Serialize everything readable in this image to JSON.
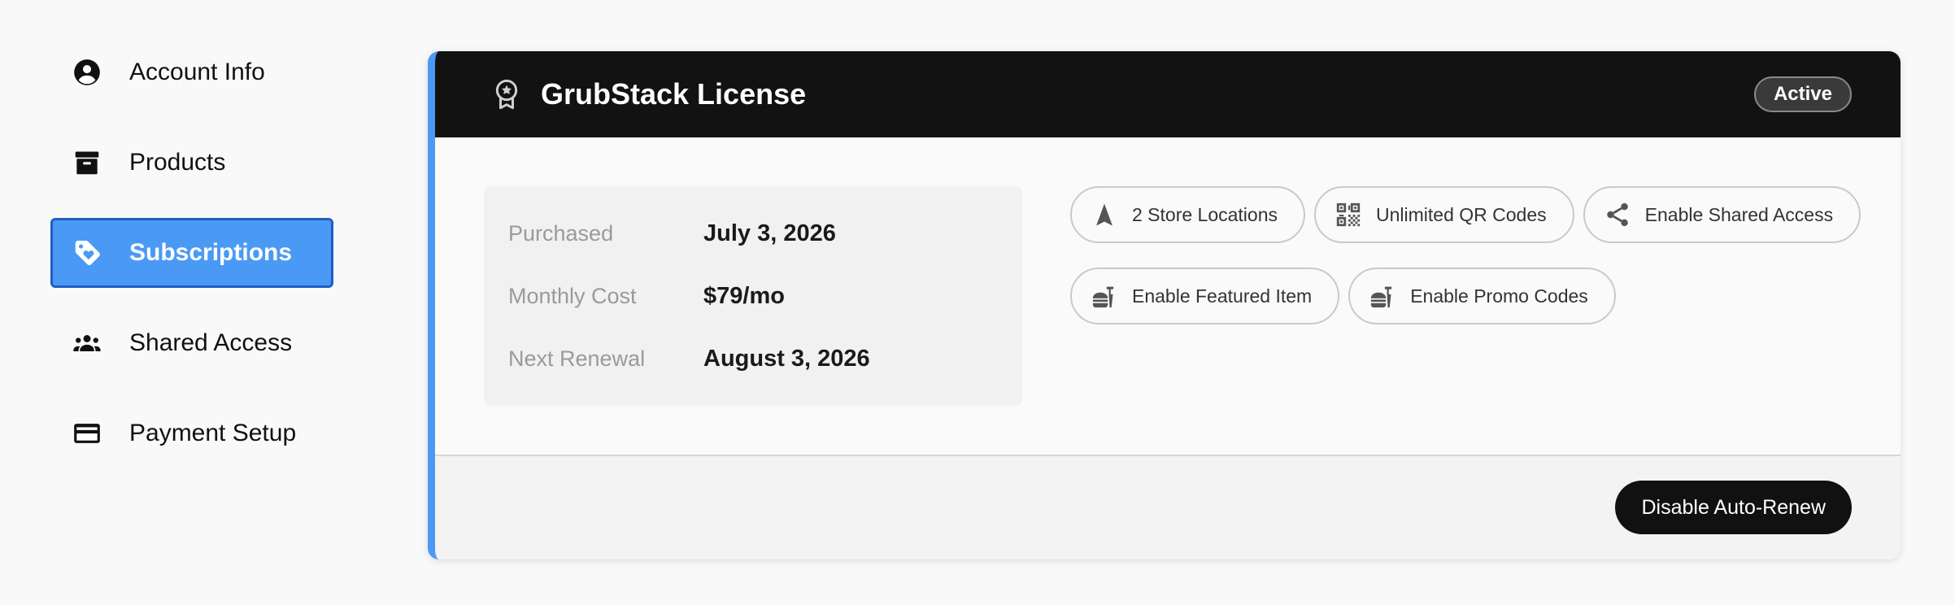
{
  "sidebar": {
    "items": [
      {
        "label": "Account Info",
        "icon": "account-circle-icon",
        "active": false
      },
      {
        "label": "Products",
        "icon": "archive-box-icon",
        "active": false
      },
      {
        "label": "Subscriptions",
        "icon": "tag-icon",
        "active": true
      },
      {
        "label": "Shared Access",
        "icon": "group-icon",
        "active": false
      },
      {
        "label": "Payment Setup",
        "icon": "credit-card-icon",
        "active": false
      }
    ]
  },
  "license": {
    "title": "GrubStack License",
    "icon": "award-badge-icon",
    "status": "Active",
    "details": [
      {
        "key": "Purchased",
        "value": "July 3, 2026"
      },
      {
        "key": "Monthly Cost",
        "value": "$79/mo"
      },
      {
        "key": "Next Renewal",
        "value": "August 3, 2026"
      }
    ],
    "features": [
      {
        "label": "2 Store Locations",
        "icon": "navigation-arrow-icon"
      },
      {
        "label": "Unlimited QR Codes",
        "icon": "qr-code-icon"
      },
      {
        "label": "Enable Shared Access",
        "icon": "share-icon"
      },
      {
        "label": "Enable Featured Item",
        "icon": "fastfood-icon"
      },
      {
        "label": "Enable Promo Codes",
        "icon": "fastfood-icon"
      }
    ],
    "action_label": "Disable Auto-Renew"
  },
  "colors": {
    "accent": "#4a9af5",
    "accent_border": "#1f5fc4",
    "header_bg": "#121212",
    "button_bg": "#111111"
  }
}
